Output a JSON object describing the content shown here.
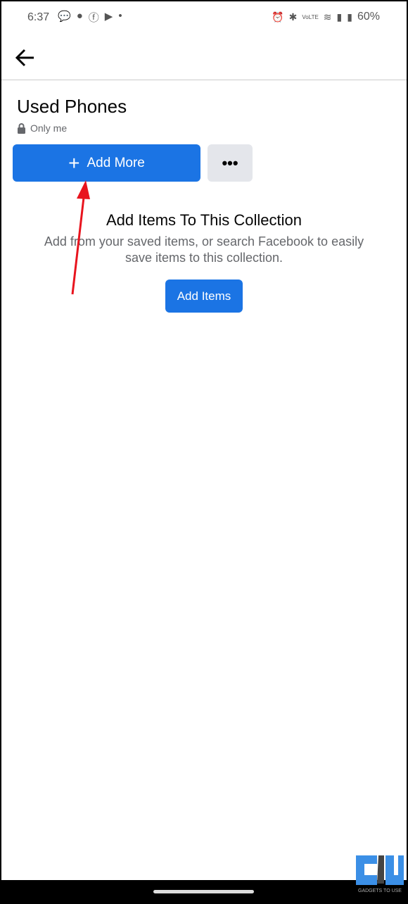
{
  "status_bar": {
    "time": "6:37",
    "battery": "60%",
    "left_icons": [
      "chat-icon",
      "location-icon",
      "facebook-icon",
      "youtube-icon",
      "dot-icon"
    ],
    "right_icons": [
      "alarm-icon",
      "bluetooth-icon",
      "volte-icon",
      "wifi-icon",
      "signal-icon",
      "battery-icon"
    ]
  },
  "collection": {
    "title": "Used Phones",
    "privacy": "Only me"
  },
  "buttons": {
    "add_more": "Add More",
    "more": "•••",
    "add_items": "Add Items"
  },
  "empty_state": {
    "heading": "Add Items To This Collection",
    "description": "Add from your saved items, or search Facebook to easily save items to this collection."
  },
  "colors": {
    "primary": "#1b74e4",
    "annotation_arrow": "#e8141e"
  },
  "watermark": "GADGETS TO USE"
}
